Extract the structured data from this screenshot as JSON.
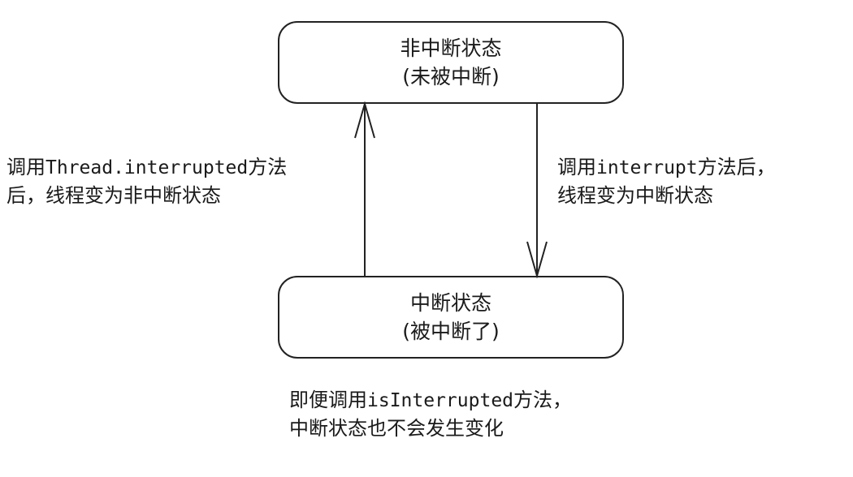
{
  "states": {
    "non_interrupted": {
      "title": "非中断状态",
      "subtitle": "(未被中断)"
    },
    "interrupted": {
      "title": "中断状态",
      "subtitle": "(被中断了)"
    }
  },
  "transitions": {
    "to_non_interrupted": {
      "pre": "调用",
      "method": "Thread.interrupted",
      "post": "方法",
      "line2": "后，线程变为非中断状态"
    },
    "to_interrupted": {
      "pre": "调用",
      "method": "interrupt",
      "post": "方法后，",
      "line2": "线程变为中断状态"
    },
    "self_note": {
      "pre": "即便调用",
      "method": "isInterrupted",
      "post": "方法，",
      "line2": "中断状态也不会发生变化"
    }
  }
}
